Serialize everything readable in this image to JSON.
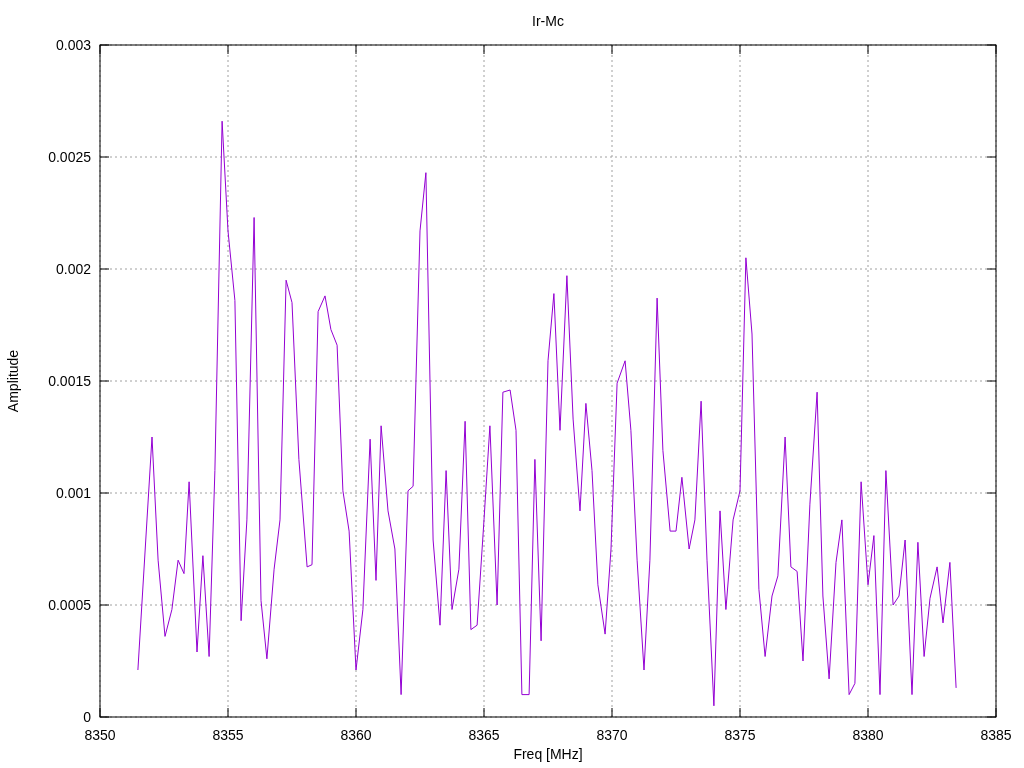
{
  "chart_data": {
    "type": "line",
    "title": "Ir-Mc",
    "xlabel": "Freq [MHz]",
    "ylabel": "Amplitude",
    "xlim": [
      8350,
      8385
    ],
    "ylim": [
      0,
      0.003
    ],
    "grid": true,
    "xticks": [
      8350,
      8355,
      8360,
      8365,
      8370,
      8375,
      8380,
      8385
    ],
    "yticks": [
      0,
      0.0005,
      0.001,
      0.0015,
      0.002,
      0.0025,
      0.003
    ],
    "x": [
      8351.48,
      8352.03,
      8352.27,
      8352.54,
      8352.81,
      8353.05,
      8353.28,
      8353.48,
      8353.79,
      8354.02,
      8354.26,
      8354.49,
      8354.77,
      8355.0,
      8355.27,
      8355.51,
      8355.74,
      8356.02,
      8356.29,
      8356.52,
      8356.8,
      8357.03,
      8357.27,
      8357.5,
      8357.77,
      8358.09,
      8358.28,
      8358.52,
      8358.79,
      8359.02,
      8359.26,
      8359.49,
      8359.73,
      8360.0,
      8360.27,
      8360.55,
      8360.78,
      8360.98,
      8361.25,
      8361.52,
      8361.76,
      8362.03,
      8362.23,
      8362.5,
      8362.73,
      8363.01,
      8363.28,
      8363.52,
      8363.75,
      8364.02,
      8364.26,
      8364.49,
      8364.73,
      8365.0,
      8365.23,
      8365.51,
      8365.74,
      8366.02,
      8366.25,
      8366.48,
      8366.76,
      8366.99,
      8367.23,
      8367.5,
      8367.73,
      8367.97,
      8368.24,
      8368.48,
      8368.75,
      8368.98,
      8369.22,
      8369.45,
      8369.73,
      8369.96,
      8370.2,
      8370.51,
      8370.74,
      8370.98,
      8371.25,
      8371.48,
      8371.76,
      8371.99,
      8372.27,
      8372.5,
      8372.73,
      8373.01,
      8373.24,
      8373.48,
      8373.71,
      8373.98,
      8374.22,
      8374.45,
      8374.73,
      8375.0,
      8375.23,
      8375.47,
      8375.74,
      8375.98,
      8376.25,
      8376.48,
      8376.76,
      8376.99,
      8377.23,
      8377.46,
      8377.73,
      8378.01,
      8378.24,
      8378.48,
      8378.75,
      8378.98,
      8379.26,
      8379.49,
      8379.73,
      8380.0,
      8380.23,
      8380.47,
      8380.7,
      8380.98,
      8381.21,
      8381.45,
      8381.72,
      8381.95,
      8382.19,
      8382.42,
      8382.7,
      8382.93,
      8383.2,
      8383.44
    ],
    "series": [
      {
        "color": "#9400d3",
        "values": [
          0.00021,
          0.00125,
          0.0007,
          0.00036,
          0.00048,
          0.0007,
          0.00064,
          0.00105,
          0.00029,
          0.00072,
          0.00027,
          0.0011,
          0.00266,
          0.00217,
          0.00186,
          0.00043,
          0.00088,
          0.00223,
          0.00052,
          0.00026,
          0.00066,
          0.00088,
          0.00195,
          0.00185,
          0.00115,
          0.00067,
          0.00068,
          0.00181,
          0.00188,
          0.00173,
          0.00166,
          0.00101,
          0.00083,
          0.00021,
          0.00048,
          0.00124,
          0.00061,
          0.0013,
          0.00092,
          0.00075,
          0.0001,
          0.00101,
          0.00103,
          0.00217,
          0.00243,
          0.00079,
          0.00041,
          0.0011,
          0.00048,
          0.00066,
          0.00132,
          0.00039,
          0.00041,
          0.00088,
          0.0013,
          0.0005,
          0.00145,
          0.00146,
          0.00128,
          0.0001,
          0.0001,
          0.00115,
          0.00034,
          0.00159,
          0.00189,
          0.00128,
          0.00197,
          0.00133,
          0.00092,
          0.0014,
          0.0011,
          0.00059,
          0.00037,
          0.00075,
          0.00149,
          0.00159,
          0.00128,
          0.0007,
          0.00021,
          0.0007,
          0.00187,
          0.00119,
          0.00083,
          0.00083,
          0.00107,
          0.00075,
          0.00088,
          0.00141,
          0.0007,
          5e-05,
          0.00092,
          0.00048,
          0.00088,
          0.00101,
          0.00205,
          0.00171,
          0.00057,
          0.00027,
          0.00054,
          0.00063,
          0.00125,
          0.00067,
          0.00065,
          0.00025,
          0.00095,
          0.00145,
          0.00054,
          0.00017,
          0.00069,
          0.00088,
          0.0001,
          0.00015,
          0.00105,
          0.00059,
          0.00081,
          0.0001,
          0.0011,
          0.0005,
          0.00054,
          0.00079,
          0.0001,
          0.00078,
          0.00027,
          0.00053,
          0.00067,
          0.00042,
          0.00069,
          0.00013
        ]
      }
    ]
  }
}
